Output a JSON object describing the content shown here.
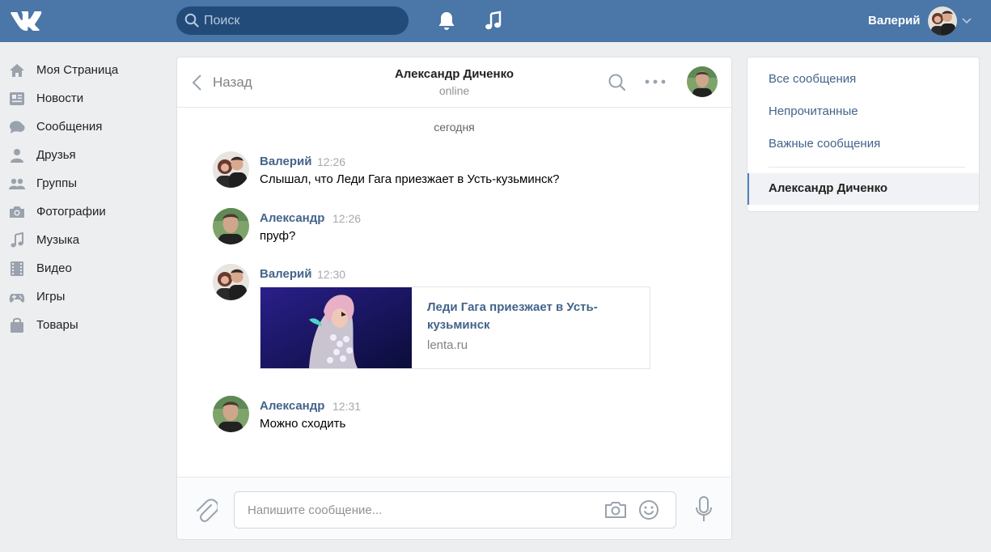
{
  "header": {
    "search_placeholder": "Поиск",
    "user_name": "Валерий"
  },
  "nav": {
    "items": [
      {
        "label": "Моя Страница",
        "icon": "home-icon"
      },
      {
        "label": "Новости",
        "icon": "news-icon"
      },
      {
        "label": "Сообщения",
        "icon": "messages-icon"
      },
      {
        "label": "Друзья",
        "icon": "friends-icon"
      },
      {
        "label": "Группы",
        "icon": "groups-icon"
      },
      {
        "label": "Фотографии",
        "icon": "camera-icon"
      },
      {
        "label": "Музыка",
        "icon": "music-icon"
      },
      {
        "label": "Видео",
        "icon": "video-icon"
      },
      {
        "label": "Игры",
        "icon": "gamepad-icon"
      },
      {
        "label": "Товары",
        "icon": "bag-icon"
      }
    ]
  },
  "chat": {
    "back_label": "Назад",
    "peer_name": "Александр Диченко",
    "peer_status": "online",
    "day_separator": "сегодня",
    "messages": [
      {
        "author": "Валерий",
        "time": "12:26",
        "text": "Слышал, что Леди Гага приезжает в Усть-кузьминск?"
      },
      {
        "author": "Александр",
        "time": "12:26",
        "text": "пруф?"
      },
      {
        "author": "Валерий",
        "time": "12:30",
        "link": {
          "title": "Леди Гага приезжает в Усть-кузьминск",
          "domain": "lenta.ru"
        }
      },
      {
        "author": "Александр",
        "time": "12:31",
        "text": "Можно сходить"
      }
    ],
    "composer_placeholder": "Напишите сообщение..."
  },
  "right_panel": {
    "filters": [
      "Все сообщения",
      "Непрочитанные",
      "Важные сообщения"
    ],
    "active_conversation": "Александр Диченко"
  },
  "colors": {
    "header_bg": "#4a76a8",
    "link_blue": "#42648b",
    "page_bg": "#edeef0"
  }
}
